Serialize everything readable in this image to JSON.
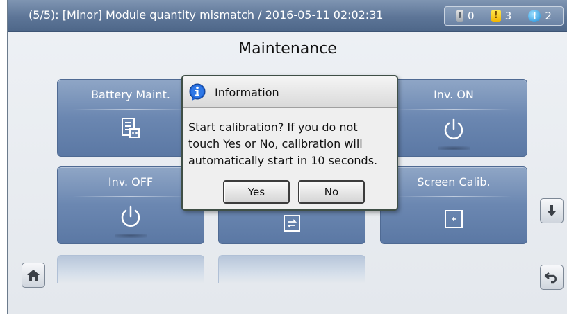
{
  "alarm_bar": {
    "message": "(5/5): [Minor] Module quantity mismatch / 2016-05-11 02:02:31",
    "critical_count": "0",
    "major_count": "3",
    "minor_count": "2"
  },
  "page": {
    "title": "Maintenance"
  },
  "tiles": {
    "battery": "Battery Maint.",
    "inv_on": "Inv. ON",
    "inv_off": "Inv. OFF",
    "screen_calib": "Screen Calib."
  },
  "dialog": {
    "title": "Information",
    "message_lines": [
      "Start calibration? If you do not",
      "touch Yes or No, calibration will",
      "automatically start in 10 seconds."
    ],
    "yes_label": "Yes",
    "no_label": "No"
  },
  "icons": {
    "critical": "critical-alarm-icon",
    "major": "major-alarm-icon",
    "minor": "minor-alarm-icon",
    "info": "info-icon",
    "home": "home-icon",
    "scroll_down": "arrow-down-icon",
    "back": "back-icon"
  },
  "colors": {
    "topbar": "#5d7597",
    "tile": "#6b87b1",
    "major_alarm": "#f2b400",
    "minor_alarm": "#1a8ad6"
  }
}
